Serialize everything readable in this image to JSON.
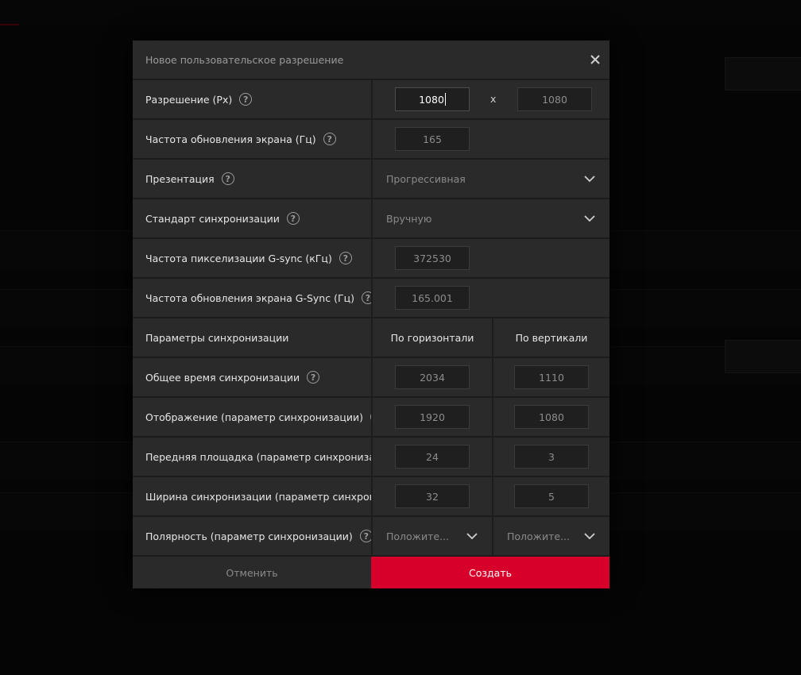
{
  "dialog": {
    "title": "Новое пользовательское разрешение",
    "close_icon": "close-icon"
  },
  "rows": {
    "resolution": {
      "label": "Разрешение (Px)",
      "width": "1080",
      "separator": "x",
      "height": "1080"
    },
    "refresh_rate": {
      "label": "Частота обновления экрана (Гц)",
      "value": "165"
    },
    "presentation": {
      "label": "Презентация",
      "selected": "Прогрессивная"
    },
    "sync_standard": {
      "label": "Стандарт синхронизации",
      "selected": "Вручную"
    },
    "gsync_pixel_clock": {
      "label": "Частота пикселизации G-sync (кГц)",
      "value": "372530"
    },
    "gsync_refresh": {
      "label": "Частота обновления экрана G-Sync (Гц)",
      "value": "165.001"
    },
    "timing_params": {
      "label": "Параметры синхронизации",
      "horizontal": "По горизонтали",
      "vertical": "По вертикали"
    },
    "total_timing": {
      "label": "Общее время синхронизации",
      "h": "2034",
      "v": "1110"
    },
    "display": {
      "label": "Отображение (параметр синхронизации)",
      "h": "1920",
      "v": "1080"
    },
    "front_porch": {
      "label": "Передняя площадка (параметр синхронизации)",
      "h": "24",
      "v": "3"
    },
    "sync_width": {
      "label": "Ширина синхронизации (параметр синхронизации)",
      "h": "32",
      "v": "5"
    },
    "polarity": {
      "label": "Полярность (параметр синхронизации)",
      "h": "Положите...",
      "v": "Положите..."
    }
  },
  "footer": {
    "cancel": "Отменить",
    "create": "Создать"
  },
  "colors": {
    "accent": "#d6002a",
    "panel": "#2a2a2a",
    "background": "#000000"
  }
}
